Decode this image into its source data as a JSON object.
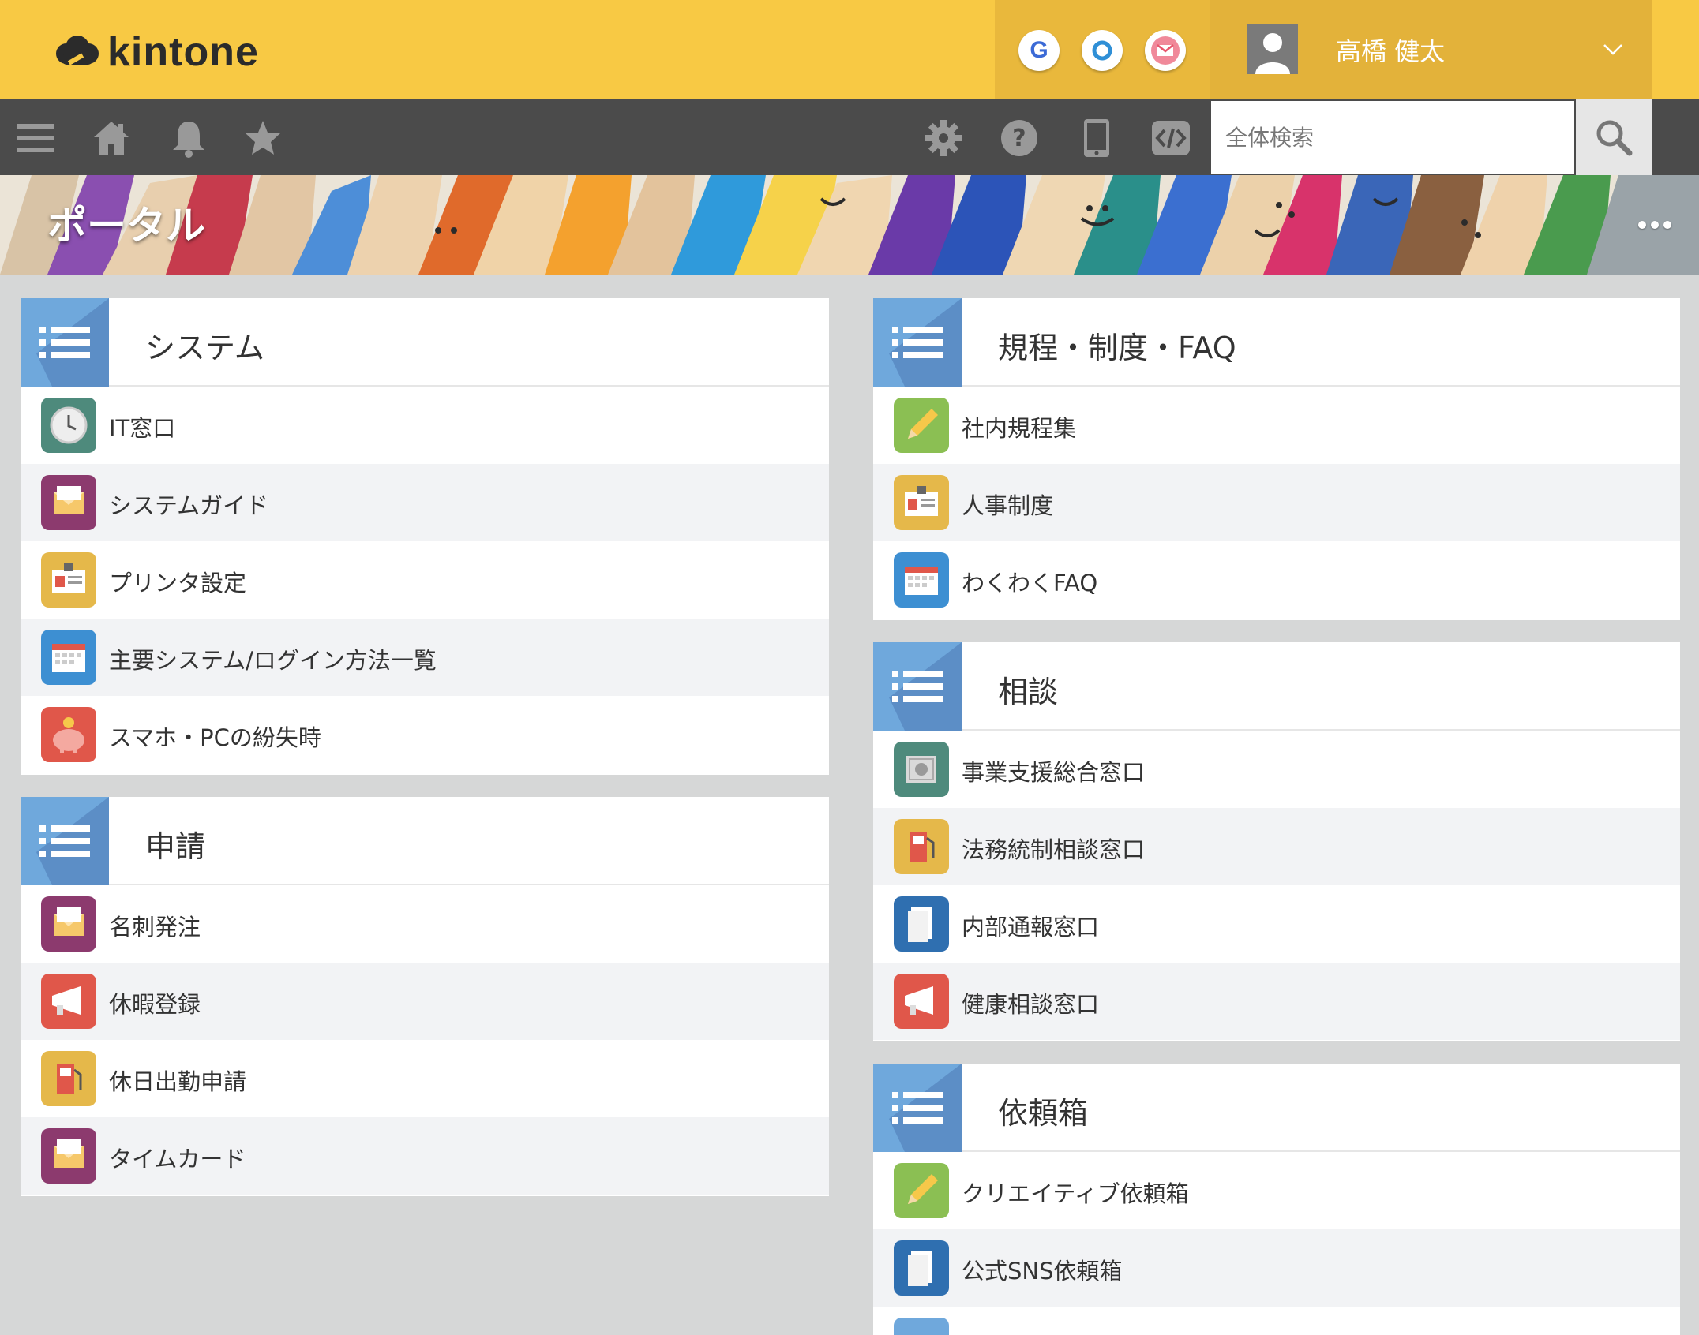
{
  "header": {
    "logo_text": "kintone",
    "services": [
      {
        "name": "google-service",
        "letter": "G",
        "color": "#3b6ad6"
      },
      {
        "name": "office-service",
        "letter": "O",
        "color": "#2f8fd6"
      },
      {
        "name": "mail-service",
        "letter": "",
        "color": "#e8556c"
      }
    ],
    "user_name": "高橋 健太"
  },
  "toolbar": {
    "search_placeholder": "全体検索"
  },
  "banner": {
    "title": "ポータル"
  },
  "panels": {
    "system": {
      "title": "システム",
      "items": [
        {
          "label": "IT窓口",
          "icon": "clock-icon",
          "color": "#4e8a7c"
        },
        {
          "label": "システムガイド",
          "icon": "envelope-icon",
          "color": "#8c3a6e"
        },
        {
          "label": "プリンタ設定",
          "icon": "id-card-icon",
          "color": "#e5b84a"
        },
        {
          "label": "主要システム/ログイン方法一覧",
          "icon": "calendar-icon",
          "color": "#3d8fd2"
        },
        {
          "label": "スマホ・PCの紛失時",
          "icon": "piggy-bank-icon",
          "color": "#e0574a"
        }
      ]
    },
    "application": {
      "title": "申請",
      "items": [
        {
          "label": "名刺発注",
          "icon": "envelope-icon",
          "color": "#8c3a6e"
        },
        {
          "label": "休暇登録",
          "icon": "megaphone-icon",
          "color": "#e0574a"
        },
        {
          "label": "休日出勤申請",
          "icon": "gas-pump-icon",
          "color": "#e5b84a"
        },
        {
          "label": "タイムカード",
          "icon": "envelope-icon",
          "color": "#8c3a6e"
        }
      ]
    },
    "rules": {
      "title": "規程・制度・FAQ",
      "items": [
        {
          "label": "社内規程集",
          "icon": "pencil-icon",
          "color": "#8bbf53"
        },
        {
          "label": "人事制度",
          "icon": "id-card-icon",
          "color": "#e5b84a"
        },
        {
          "label": "わくわくFAQ",
          "icon": "calendar-icon",
          "color": "#3d8fd2"
        }
      ]
    },
    "consult": {
      "title": "相談",
      "items": [
        {
          "label": "事業支援総合窓口",
          "icon": "safe-icon",
          "color": "#4e8a7c"
        },
        {
          "label": "法務統制相談窓口",
          "icon": "gas-pump-icon",
          "color": "#e5b84a"
        },
        {
          "label": "内部通報窓口",
          "icon": "document-icon",
          "color": "#2f6fb0"
        },
        {
          "label": "健康相談窓口",
          "icon": "megaphone-icon",
          "color": "#e0574a"
        }
      ]
    },
    "request": {
      "title": "依頼箱",
      "items": [
        {
          "label": "クリエイティブ依頼箱",
          "icon": "pencil-icon",
          "color": "#8bbf53"
        },
        {
          "label": "公式SNS依頼箱",
          "icon": "document-icon",
          "color": "#2f6fb0"
        }
      ]
    }
  }
}
